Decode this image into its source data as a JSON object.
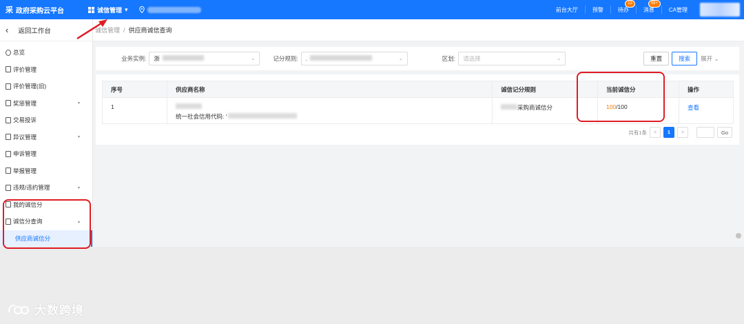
{
  "header": {
    "logo_mark": "采",
    "platform_title": "政府采购云平台",
    "module_label": "诚信管理",
    "module_caret": "▾",
    "nav": [
      {
        "label": "前台大厅"
      },
      {
        "label": "预警"
      },
      {
        "label": "待办",
        "badge": "13"
      },
      {
        "label": "消息",
        "badge": "99+"
      },
      {
        "label": "CA管理"
      }
    ]
  },
  "sidebar": {
    "back_label": "返回工作台",
    "items": [
      {
        "label": "总览",
        "icon": "circle-icon"
      },
      {
        "label": "评价管理",
        "icon": "doc-icon"
      },
      {
        "label": "评价管理(旧)",
        "icon": "doc-icon"
      },
      {
        "label": "奖惩管理",
        "icon": "doc-icon",
        "arrow": "▾"
      },
      {
        "label": "交易投诉",
        "icon": "doc-icon"
      },
      {
        "label": "异议管理",
        "icon": "doc-icon",
        "arrow": "▾"
      },
      {
        "label": "申诉管理",
        "icon": "doc-icon"
      },
      {
        "label": "举报管理",
        "icon": "doc-icon"
      },
      {
        "label": "违规/违约管理",
        "icon": "doc-icon",
        "arrow": "▾"
      },
      {
        "label": "我的诚信分",
        "icon": "doc-icon"
      },
      {
        "label": "诚信分查询",
        "icon": "doc-icon",
        "arrow": "▴"
      }
    ],
    "active_sub": "供应商诚信分"
  },
  "breadcrumb": {
    "parent": "诚信管理",
    "sep": "/",
    "current": "供应商诚信查询"
  },
  "filters": {
    "business_label": "业务实例:",
    "business_value": "浙",
    "rule_label": "记分规则:",
    "rule_value": ".",
    "region_label": "区划:",
    "region_placeholder": "请选择",
    "reset_label": "重置",
    "search_label": "搜索",
    "expand_label": "展开",
    "expand_caret": "⌄"
  },
  "table": {
    "headers": [
      "序号",
      "供应商名称",
      "诚信记分规则",
      "当前诚信分",
      "操作"
    ],
    "rows": [
      {
        "index": "1",
        "credit_code_label": "统一社会信用代码: '",
        "rule_suffix": "采购商诚信分",
        "score": "100",
        "score_max": "/100",
        "action": "查看"
      }
    ]
  },
  "pagination": {
    "total_text": "共有1条",
    "prev": "<",
    "current_page": "1",
    "next": ">",
    "go_label": "Go"
  },
  "watermark": "大数跨境",
  "colors": {
    "primary": "#1677ff",
    "highlight": "#e01b24",
    "score": "#ff7a00"
  }
}
